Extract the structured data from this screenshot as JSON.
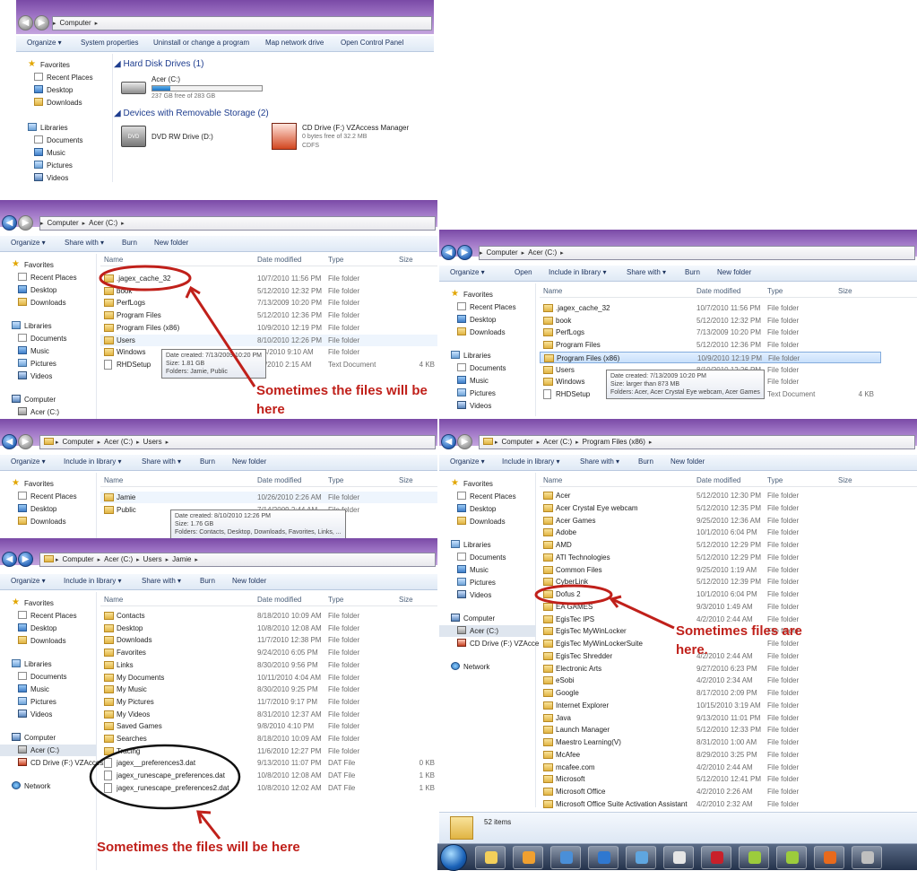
{
  "win1": {
    "breadcrumb": [
      "Computer"
    ],
    "toolbar": [
      "Organize ▾",
      "System properties",
      "Uninstall or change a program",
      "Map network drive",
      "Open Control Panel"
    ],
    "nav": [
      "Favorites",
      "Recent Places",
      "Desktop",
      "Downloads",
      "Libraries",
      "Documents",
      "Music",
      "Pictures",
      "Videos"
    ],
    "hdd_header": "Hard Disk Drives (1)",
    "removable_header": "Devices with Removable Storage (2)",
    "drive_c": {
      "name": "Acer (C:)",
      "free": "237 GB free of 283 GB",
      "used_fraction": 0.16
    },
    "dvd": {
      "name": "DVD RW Drive (D:)"
    },
    "cd": {
      "name": "CD Drive (F:) VZAccess Manager",
      "free": "0 bytes free of 32.2 MB",
      "fs": "CDFS"
    }
  },
  "win2": {
    "breadcrumb": [
      "Computer",
      "Acer (C:)"
    ],
    "toolbar": [
      "Organize ▾",
      "Share with ▾",
      "Burn",
      "New folder"
    ],
    "nav": [
      "Favorites",
      "Recent Places",
      "Desktop",
      "Downloads",
      "Libraries",
      "Documents",
      "Music",
      "Pictures",
      "Videos",
      "Computer",
      "Acer (C:)"
    ],
    "columns": [
      "Name",
      "Date modified",
      "Type",
      "Size"
    ],
    "rows": [
      {
        "name": ".jagex_cache_32",
        "date": "10/7/2010 11:56 PM",
        "type": "File folder",
        "size": ""
      },
      {
        "name": "book",
        "date": "5/12/2010 12:32 PM",
        "type": "File folder",
        "size": ""
      },
      {
        "name": "PerfLogs",
        "date": "7/13/2009 10:20 PM",
        "type": "File folder",
        "size": ""
      },
      {
        "name": "Program Files",
        "date": "5/12/2010 12:36 PM",
        "type": "File folder",
        "size": ""
      },
      {
        "name": "Program Files (x86)",
        "date": "10/9/2010 12:19 PM",
        "type": "File folder",
        "size": ""
      },
      {
        "name": "Users",
        "date": "8/10/2010 12:26 PM",
        "type": "File folder",
        "size": ""
      },
      {
        "name": "Windows",
        "date": "8/4/2010 9:10 AM",
        "type": "File folder",
        "size": ""
      },
      {
        "name": "RHDSetup",
        "date": "10/2010 2:15 AM",
        "type": "Text Document",
        "size": "4 KB"
      }
    ],
    "tooltip": [
      "Date created: 7/13/2009 10:20 PM",
      "Size: 1.81 GB",
      "Folders: Jamie, Public"
    ],
    "annotation": "Sometimes the files will be here"
  },
  "win3": {
    "breadcrumb": [
      "Computer",
      "Acer (C:)"
    ],
    "toolbar": [
      "Organize ▾",
      "Open",
      "Include in library ▾",
      "Share with ▾",
      "Burn",
      "New folder"
    ],
    "nav": [
      "Favorites",
      "Recent Places",
      "Desktop",
      "Downloads",
      "Libraries",
      "Documents",
      "Music",
      "Pictures",
      "Videos"
    ],
    "columns": [
      "Name",
      "Date modified",
      "Type",
      "Size"
    ],
    "rows": [
      {
        "name": ".jagex_cache_32",
        "date": "10/7/2010 11:56 PM",
        "type": "File folder",
        "size": ""
      },
      {
        "name": "book",
        "date": "5/12/2010 12:32 PM",
        "type": "File folder",
        "size": ""
      },
      {
        "name": "PerfLogs",
        "date": "7/13/2009 10:20 PM",
        "type": "File folder",
        "size": ""
      },
      {
        "name": "Program Files",
        "date": "5/12/2010 12:36 PM",
        "type": "File folder",
        "size": ""
      },
      {
        "name": "Program Files (x86)",
        "date": "10/9/2010 12:19 PM",
        "type": "File folder",
        "size": ""
      },
      {
        "name": "Users",
        "date": "8/10/2010 12:26 PM",
        "type": "File folder",
        "size": ""
      },
      {
        "name": "Windows",
        "date": "8/4/2010 9:10 AM",
        "type": "File folder",
        "size": ""
      },
      {
        "name": "RHDSetup",
        "date": "10/2010 2:15 AM",
        "type": "Text Document",
        "size": "4 KB"
      }
    ],
    "tooltip": [
      "Date created: 7/13/2009 10:20 PM",
      "Size: larger than 873 MB",
      "Folders: Acer, Acer Crystal Eye webcam, Acer Games"
    ]
  },
  "win4": {
    "breadcrumb": [
      "Computer",
      "Acer (C:)",
      "Users"
    ],
    "toolbar": [
      "Organize ▾",
      "Include in library ▾",
      "Share with ▾",
      "Burn",
      "New folder"
    ],
    "nav": [
      "Favorites",
      "Recent Places",
      "Desktop",
      "Downloads"
    ],
    "columns": [
      "Name",
      "Date modified",
      "Type",
      "Size"
    ],
    "rows": [
      {
        "name": "Jamie",
        "date": "10/26/2010 2:26 AM",
        "type": "File folder",
        "size": ""
      },
      {
        "name": "Public",
        "date": "7/14/2009 2:44 AM",
        "type": "File folder",
        "size": ""
      }
    ],
    "tooltip": [
      "Date created: 8/10/2010 12:26 PM",
      "Size: 1.76 GB",
      "Folders: Contacts, Desktop, Downloads, Favorites, Links, ..."
    ]
  },
  "win5": {
    "breadcrumb": [
      "Computer",
      "Acer (C:)",
      "Users",
      "Jamie"
    ],
    "toolbar": [
      "Organize ▾",
      "Include in library ▾",
      "Share with ▾",
      "Burn",
      "New folder"
    ],
    "nav": [
      "Favorites",
      "Recent Places",
      "Desktop",
      "Downloads",
      "Libraries",
      "Documents",
      "Music",
      "Pictures",
      "Videos",
      "Computer",
      "Acer (C:)",
      "CD Drive (F:) VZAccess",
      "Network"
    ],
    "columns": [
      "Name",
      "Date modified",
      "Type",
      "Size"
    ],
    "rows": [
      {
        "name": "Contacts",
        "date": "8/18/2010 10:09 AM",
        "type": "File folder",
        "size": "",
        "kind": "folder"
      },
      {
        "name": "Desktop",
        "date": "10/8/2010 12:08 AM",
        "type": "File folder",
        "size": "",
        "kind": "folder"
      },
      {
        "name": "Downloads",
        "date": "11/7/2010 12:38 PM",
        "type": "File folder",
        "size": "",
        "kind": "folder"
      },
      {
        "name": "Favorites",
        "date": "9/24/2010 6:05 PM",
        "type": "File folder",
        "size": "",
        "kind": "folder"
      },
      {
        "name": "Links",
        "date": "8/30/2010 9:56 PM",
        "type": "File folder",
        "size": "",
        "kind": "folder"
      },
      {
        "name": "My Documents",
        "date": "10/11/2010 4:04 AM",
        "type": "File folder",
        "size": "",
        "kind": "folder"
      },
      {
        "name": "My Music",
        "date": "8/30/2010 9:25 PM",
        "type": "File folder",
        "size": "",
        "kind": "folder"
      },
      {
        "name": "My Pictures",
        "date": "11/7/2010 9:17 PM",
        "type": "File folder",
        "size": "",
        "kind": "folder"
      },
      {
        "name": "My Videos",
        "date": "8/31/2010 12:37 AM",
        "type": "File folder",
        "size": "",
        "kind": "folder"
      },
      {
        "name": "Saved Games",
        "date": "9/8/2010 4:10 PM",
        "type": "File folder",
        "size": "",
        "kind": "folder"
      },
      {
        "name": "Searches",
        "date": "8/18/2010 10:09 AM",
        "type": "File folder",
        "size": "",
        "kind": "folder"
      },
      {
        "name": "Tracing",
        "date": "11/6/2010 12:27 PM",
        "type": "File folder",
        "size": "",
        "kind": "folder"
      },
      {
        "name": "jagex__preferences3.dat",
        "date": "9/13/2010 11:07 PM",
        "type": "DAT File",
        "size": "0 KB",
        "kind": "file"
      },
      {
        "name": "jagex_runescape_preferences.dat",
        "date": "10/8/2010 12:08 AM",
        "type": "DAT File",
        "size": "1 KB",
        "kind": "file"
      },
      {
        "name": "jagex_runescape_preferences2.dat",
        "date": "10/8/2010 12:02 AM",
        "type": "DAT File",
        "size": "1 KB",
        "kind": "file"
      }
    ],
    "annotation": "Sometimes the files will be here"
  },
  "win6": {
    "breadcrumb": [
      "Computer",
      "Acer (C:)",
      "Program Files (x86)"
    ],
    "toolbar": [
      "Organize ▾",
      "Include in library ▾",
      "Share with ▾",
      "Burn",
      "New folder"
    ],
    "nav": [
      "Favorites",
      "Recent Places",
      "Desktop",
      "Downloads",
      "Libraries",
      "Documents",
      "Music",
      "Pictures",
      "Videos",
      "Computer",
      "Acer (C:)",
      "CD Drive (F:) VZAcce",
      "Network"
    ],
    "columns": [
      "Name",
      "Date modified",
      "Type",
      "Size"
    ],
    "rows": [
      {
        "name": "Acer",
        "date": "5/12/2010 12:30 PM",
        "type": "File folder"
      },
      {
        "name": "Acer Crystal Eye webcam",
        "date": "5/12/2010 12:35 PM",
        "type": "File folder"
      },
      {
        "name": "Acer Games",
        "date": "9/25/2010 12:36 AM",
        "type": "File folder"
      },
      {
        "name": "Adobe",
        "date": "10/1/2010 6:04 PM",
        "type": "File folder"
      },
      {
        "name": "AMD",
        "date": "5/12/2010 12:29 PM",
        "type": "File folder"
      },
      {
        "name": "ATI Technologies",
        "date": "5/12/2010 12:29 PM",
        "type": "File folder"
      },
      {
        "name": "Common Files",
        "date": "9/25/2010 1:19 AM",
        "type": "File folder"
      },
      {
        "name": "CyberLink",
        "date": "5/12/2010 12:39 PM",
        "type": "File folder"
      },
      {
        "name": "Dofus 2",
        "date": "10/1/2010 6:04 PM",
        "type": "File folder"
      },
      {
        "name": "EA GAMES",
        "date": "9/3/2010 1:49 AM",
        "type": "File folder"
      },
      {
        "name": "EgisTec IPS",
        "date": "4/2/2010 2:44 AM",
        "type": "File folder"
      },
      {
        "name": "EgisTec MyWinLocker",
        "date": "",
        "type": "File folder"
      },
      {
        "name": "EgisTec MyWinLockerSuite",
        "date": "",
        "type": "File folder"
      },
      {
        "name": "EgisTec Shredder",
        "date": "4/2/2010 2:44 AM",
        "type": "File folder"
      },
      {
        "name": "Electronic Arts",
        "date": "9/27/2010 6:23 PM",
        "type": "File folder"
      },
      {
        "name": "eSobi",
        "date": "4/2/2010 2:34 AM",
        "type": "File folder"
      },
      {
        "name": "Google",
        "date": "8/17/2010 2:09 PM",
        "type": "File folder"
      },
      {
        "name": "Internet Explorer",
        "date": "10/15/2010 3:19 AM",
        "type": "File folder"
      },
      {
        "name": "Java",
        "date": "9/13/2010 11:01 PM",
        "type": "File folder"
      },
      {
        "name": "Launch Manager",
        "date": "5/12/2010 12:33 PM",
        "type": "File folder"
      },
      {
        "name": "Maestro Learning(V)",
        "date": "8/31/2010 1:00 AM",
        "type": "File folder"
      },
      {
        "name": "McAfee",
        "date": "8/29/2010 3:25 PM",
        "type": "File folder"
      },
      {
        "name": "mcafee.com",
        "date": "4/2/2010 2:44 AM",
        "type": "File folder"
      },
      {
        "name": "Microsoft",
        "date": "5/12/2010 12:41 PM",
        "type": "File folder"
      },
      {
        "name": "Microsoft Office",
        "date": "4/2/2010 2:26 AM",
        "type": "File folder"
      },
      {
        "name": "Microsoft Office Suite Activation Assistant",
        "date": "4/2/2010 2:32 AM",
        "type": "File folder"
      }
    ],
    "status": "52 items",
    "annotation": "Sometimes files are here."
  },
  "taskbar": {
    "buttons": [
      "explorer-icon",
      "media-player-icon",
      "paint-icon",
      "ie-icon",
      "picture-icon",
      "tools-icon",
      "pdf-icon",
      "green-app-icon",
      "green-app-icon",
      "firefox-icon",
      "misc-icon"
    ]
  },
  "colors": {
    "annotation_red": "#c0201a",
    "titlebar_purple": "#8a5bb5",
    "selection_blue": "#c9e0fb"
  }
}
